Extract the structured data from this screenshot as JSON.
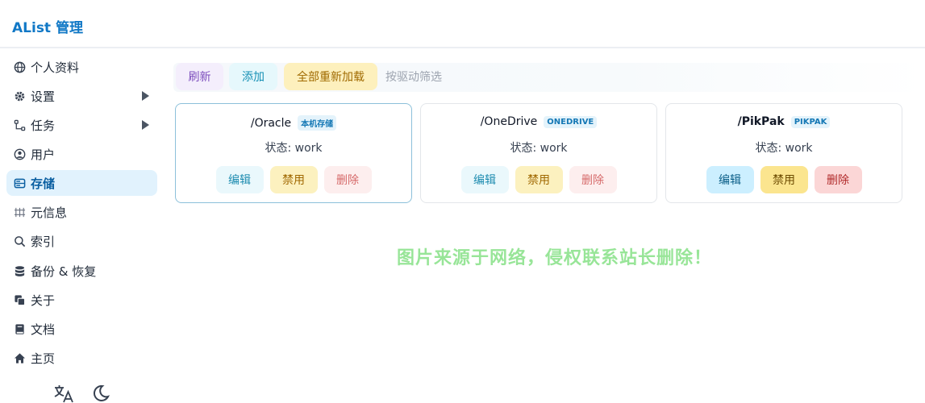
{
  "header": {
    "title": "AList 管理"
  },
  "sidebar": {
    "items": [
      {
        "label": "个人资料",
        "icon": "globe-icon"
      },
      {
        "label": "设置",
        "icon": "gear-icon",
        "expandable": true
      },
      {
        "label": "任务",
        "icon": "branch-icon",
        "expandable": true
      },
      {
        "label": "用户",
        "icon": "user-circle-icon"
      },
      {
        "label": "存储",
        "icon": "database-icon",
        "active": true
      },
      {
        "label": "元信息",
        "icon": "meta-icon"
      },
      {
        "label": "索引",
        "icon": "search-icon"
      },
      {
        "label": "备份 & 恢复",
        "icon": "stack-icon"
      },
      {
        "label": "关于",
        "icon": "copy-icon"
      },
      {
        "label": "文档",
        "icon": "book-icon"
      },
      {
        "label": "主页",
        "icon": "home-icon"
      }
    ],
    "tools": {
      "language_icon": "translate-icon",
      "theme_icon": "moon-icon"
    }
  },
  "toolbar": {
    "refresh": "刷新",
    "add": "添加",
    "reload_all": "全部重新加载",
    "filter_placeholder": "按驱动筛选"
  },
  "storages": [
    {
      "path": "/Oracle",
      "driver": "本机存储",
      "status": "状态: work",
      "edit": "编辑",
      "disable": "禁用",
      "delete": "删除"
    },
    {
      "path": "/OneDrive",
      "driver": "ONEDRIVE",
      "status": "状态: work",
      "edit": "编辑",
      "disable": "禁用",
      "delete": "删除"
    },
    {
      "path": "/PikPak",
      "driver": "PIKPAK",
      "status": "状态: work",
      "edit": "编辑",
      "disable": "禁用",
      "delete": "删除"
    }
  ],
  "watermark": "图片来源于网络，侵权联系站长删除！",
  "colors": {
    "accent": "#1178c6",
    "active_bg": "#e1f2fd",
    "watermark": "#8de38d"
  }
}
